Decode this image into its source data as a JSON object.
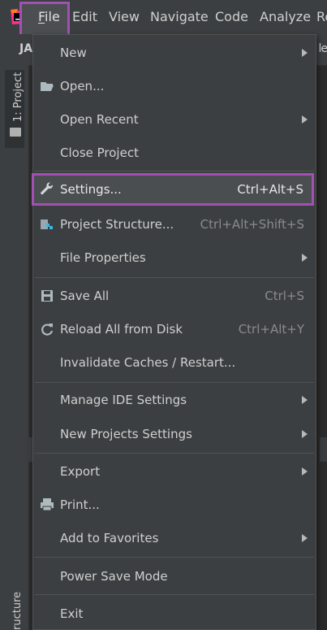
{
  "menubar": {
    "items": [
      {
        "label": "File",
        "mnemonic": "F"
      },
      {
        "label": "Edit",
        "mnemonic": "E"
      },
      {
        "label": "View",
        "mnemonic": "V"
      },
      {
        "label": "Navigate",
        "mnemonic": "N"
      },
      {
        "label": "Code",
        "mnemonic": "C"
      },
      {
        "label": "Analyze",
        "mnemonic": "z"
      },
      {
        "label": "Re"
      }
    ],
    "active_item": "File"
  },
  "subbar": {
    "left_text": "JA",
    "right_text": "le"
  },
  "tool_windows": {
    "project_label": "1: Project",
    "structure_label": "ructure"
  },
  "file_menu": {
    "items": [
      {
        "label": "New",
        "shortcut": "",
        "submenu": true,
        "icon": ""
      },
      {
        "label": "Open...",
        "shortcut": "",
        "submenu": false,
        "icon": "folder-open-icon"
      },
      {
        "label": "Open Recent",
        "shortcut": "",
        "submenu": true,
        "icon": ""
      },
      {
        "label": "Close Project",
        "shortcut": "",
        "submenu": false,
        "icon": ""
      },
      {
        "label": "Settings...",
        "shortcut": "Ctrl+Alt+S",
        "submenu": false,
        "icon": "wrench-icon",
        "selected": true
      },
      {
        "label": "Project Structure...",
        "shortcut": "Ctrl+Alt+Shift+S",
        "submenu": false,
        "icon": "project-structure-icon"
      },
      {
        "label": "File Properties",
        "shortcut": "",
        "submenu": true,
        "icon": ""
      },
      {
        "label": "Save All",
        "shortcut": "Ctrl+S",
        "submenu": false,
        "icon": "save-icon"
      },
      {
        "label": "Reload All from Disk",
        "shortcut": "Ctrl+Alt+Y",
        "submenu": false,
        "icon": "reload-icon"
      },
      {
        "label": "Invalidate Caches / Restart...",
        "shortcut": "",
        "submenu": false,
        "icon": ""
      },
      {
        "label": "Manage IDE Settings",
        "shortcut": "",
        "submenu": true,
        "icon": ""
      },
      {
        "label": "New Projects Settings",
        "shortcut": "",
        "submenu": true,
        "icon": ""
      },
      {
        "label": "Export",
        "shortcut": "",
        "submenu": true,
        "icon": ""
      },
      {
        "label": "Print...",
        "shortcut": "",
        "submenu": false,
        "icon": "print-icon"
      },
      {
        "label": "Add to Favorites",
        "shortcut": "",
        "submenu": true,
        "icon": ""
      },
      {
        "label": "Power Save Mode",
        "shortcut": "",
        "submenu": false,
        "icon": ""
      },
      {
        "label": "Exit",
        "shortcut": "",
        "submenu": false,
        "icon": ""
      }
    ]
  },
  "colors": {
    "menu_bg": "#3c3f41",
    "editor_bg": "#2b2b2b",
    "highlight_border": "#a34fb4",
    "text": "#cfcfcf",
    "shortcut_text": "#8a8a8a"
  }
}
